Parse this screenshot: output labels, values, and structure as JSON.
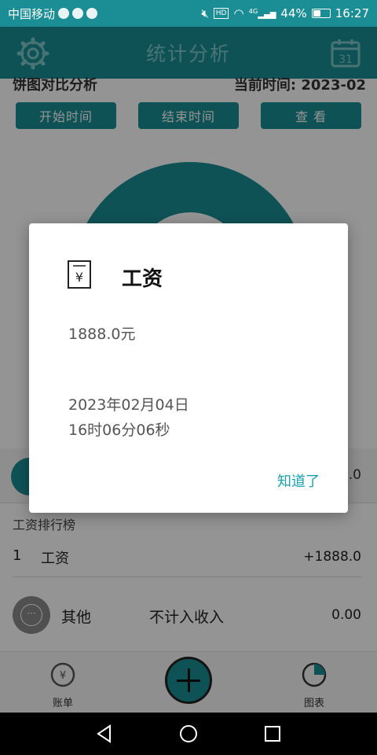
{
  "status_bar": {
    "carrier": "中国移动",
    "battery": "44%",
    "time": "16:27",
    "hd": "HD",
    "network": "4G"
  },
  "app_bar": {
    "title": "统计分析",
    "calendar_day": "31"
  },
  "filter": {
    "section_title": "饼图对比分析",
    "current_time": "当前时间: 2023-02",
    "start_button": "开始时间",
    "end_button": "结束时间",
    "view_button": "查 看"
  },
  "summary": {
    "amount_tail": "8.0"
  },
  "ranking": {
    "title": "工资排行榜",
    "rows": [
      {
        "rank": "1",
        "name": "工资",
        "value": "+1888.0"
      }
    ]
  },
  "other_row": {
    "name": "其他",
    "note": "不计入收入",
    "value": "0.00"
  },
  "bottom_nav": {
    "bill": "账单",
    "chart": "图表"
  },
  "dialog": {
    "title": "工资",
    "amount": "1888.0元",
    "date": "2023年02月04日",
    "time": "16时06分06秒",
    "confirm": "知道了"
  },
  "colors": {
    "primary": "#1b8d94",
    "accent_text": "#1aa0ad"
  }
}
